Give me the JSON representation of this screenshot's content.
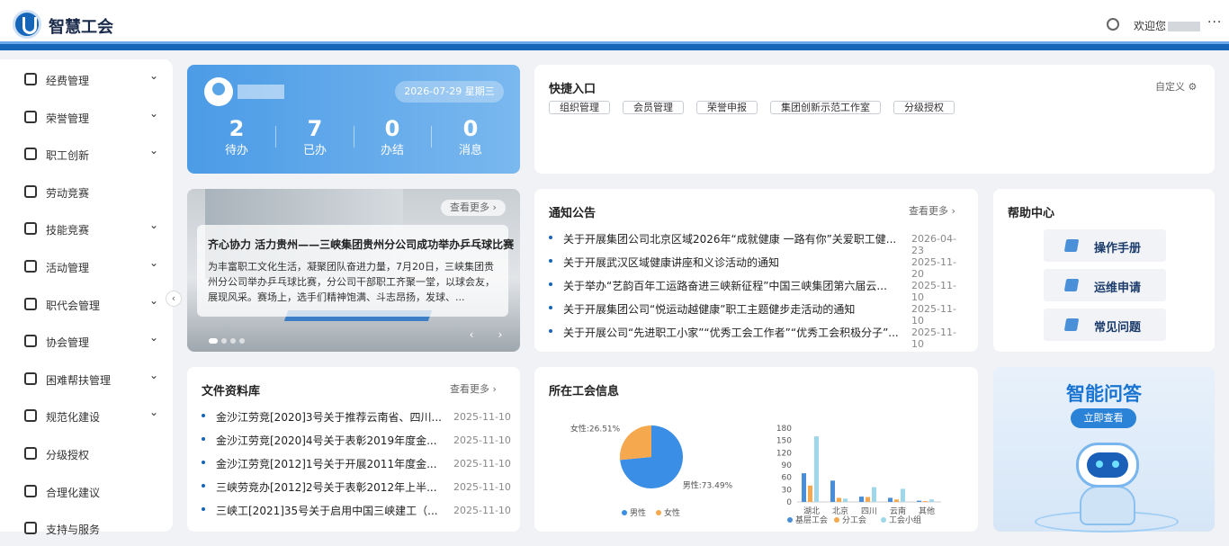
{
  "header": {
    "app_title": "智慧工会",
    "welcome": "欢迎您",
    "more": "···"
  },
  "sidebar": {
    "items": [
      {
        "label": "经费管理",
        "icon": "money-icon",
        "chevron": true
      },
      {
        "label": "荣誉管理",
        "icon": "trophy-icon",
        "chevron": true
      },
      {
        "label": "职工创新",
        "icon": "lightbulb-icon",
        "chevron": true
      },
      {
        "label": "劳动竞赛",
        "icon": "people-icon",
        "chevron": false
      },
      {
        "label": "技能竞赛",
        "icon": "skill-icon",
        "chevron": true
      },
      {
        "label": "活动管理",
        "icon": "group-icon",
        "chevron": true
      },
      {
        "label": "职代会管理",
        "icon": "phone-icon",
        "chevron": true
      },
      {
        "label": "协会管理",
        "icon": "association-icon",
        "chevron": true
      },
      {
        "label": "困难帮扶管理",
        "icon": "help-hand-icon",
        "chevron": true
      },
      {
        "label": "规范化建设",
        "icon": "map-icon",
        "chevron": true
      },
      {
        "label": "分级授权",
        "icon": "hierarchy-icon",
        "chevron": false
      },
      {
        "label": "合理化建议",
        "icon": "document-icon",
        "chevron": false
      },
      {
        "label": "支持与服务",
        "icon": "support-icon",
        "chevron": false
      }
    ]
  },
  "user_card": {
    "date": "2026-07-29 星期三",
    "stats": [
      {
        "value": "2",
        "label": "待办"
      },
      {
        "value": "7",
        "label": "已办"
      },
      {
        "value": "0",
        "label": "办结"
      },
      {
        "value": "0",
        "label": "消息"
      }
    ]
  },
  "quick": {
    "title": "快捷入口",
    "customize": "自定义",
    "tags": [
      "组织管理",
      "会员管理",
      "荣誉申报",
      "集团创新示范工作室",
      "分级授权"
    ]
  },
  "banner": {
    "more": "查看更多",
    "title": "齐心协力 活力贵州——三峡集团贵州分公司成功举办乒乓球比赛",
    "text": "为丰富职工文化生活，凝聚团队奋进力量，7月20日，三峡集团贵州分公司举办乒乓球比赛，分公司干部职工齐聚一堂，以球会友，展现风采。赛场上，选手们精神饱满、斗志昂扬，发球、..."
  },
  "notice": {
    "title": "通知公告",
    "more": "查看更多",
    "items": [
      {
        "text": "关于开展集团公司北京区域2026年“成就健康 一路有你”关爱职工健...",
        "date": "2026-04-23"
      },
      {
        "text": "关于开展武汉区域健康讲座和义诊活动的通知",
        "date": "2025-11-20"
      },
      {
        "text": "关于举办“艺韵百年工运路奋进三峡新征程”中国三峡集团第六届云...",
        "date": "2025-11-10"
      },
      {
        "text": "关于开展集团公司“悦运动越健康”职工主题健步走活动的通知",
        "date": "2025-11-10"
      },
      {
        "text": "关于开展公司“先进职工小家”“优秀工会工作者”“优秀工会积极分子”...",
        "date": "2025-11-10"
      }
    ]
  },
  "help": {
    "title": "帮助中心",
    "buttons": [
      "操作手册",
      "运维申请",
      "常见问题"
    ]
  },
  "files": {
    "title": "文件资料库",
    "more": "查看更多",
    "items": [
      {
        "text": "金沙江劳竞[2020]3号关于推荐云南省、四川...",
        "date": "2025-11-10"
      },
      {
        "text": "金沙江劳竞[2020]4号关于表彰2019年度金...",
        "date": "2025-11-10"
      },
      {
        "text": "金沙江劳竞[2012]1号关于开展2011年度金...",
        "date": "2025-11-10"
      },
      {
        "text": "三峡劳竞办[2012]2号关于表彰2012年上半...",
        "date": "2025-11-10"
      },
      {
        "text": "三峡工[2021]35号关于启用中国三峡建工（...",
        "date": "2025-11-10"
      }
    ]
  },
  "union": {
    "title": "所在工会信息"
  },
  "chart_data": [
    {
      "type": "pie",
      "slices": [
        {
          "name": "男性",
          "value": 73.49,
          "label": "男性:73.49%",
          "color": "#3a8ee6"
        },
        {
          "name": "女性",
          "value": 26.51,
          "label": "女性:26.51%",
          "color": "#f5a84e"
        }
      ],
      "legend": [
        "男性",
        "女性"
      ]
    },
    {
      "type": "bar",
      "categories": [
        "湖北",
        "北京",
        "四川",
        "云南",
        "其他"
      ],
      "ylim": [
        0,
        180
      ],
      "yticks": [
        "0",
        "30",
        "60",
        "90",
        "120",
        "150",
        "180"
      ],
      "series": [
        {
          "name": "基层工会",
          "color": "#4a8ed9",
          "values": [
            70,
            52,
            13,
            10,
            3
          ]
        },
        {
          "name": "分工会",
          "color": "#f5a84e",
          "values": [
            40,
            10,
            12,
            6,
            2
          ]
        },
        {
          "name": "工会小组",
          "color": "#9ed6ea",
          "values": [
            160,
            8,
            36,
            32,
            6
          ]
        }
      ]
    }
  ],
  "ai": {
    "title": "智能问答",
    "button": "立即查看"
  }
}
